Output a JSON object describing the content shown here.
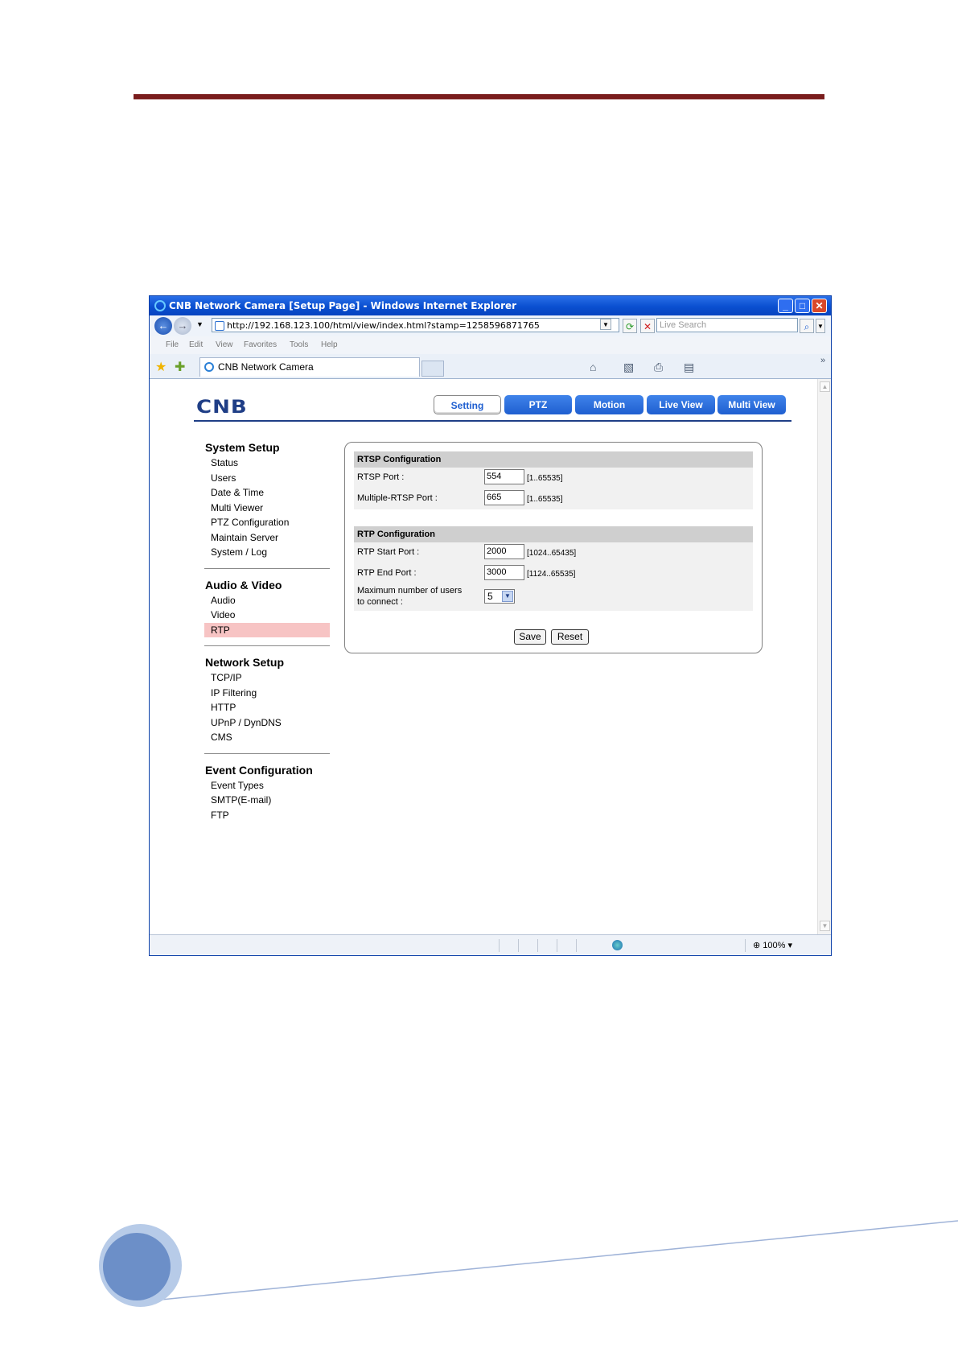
{
  "browser": {
    "window_title": "CNB Network Camera [Setup Page] - Windows Internet Explorer",
    "address": "http://192.168.123.100/html/view/index.html?stamp=1258596871765",
    "search_placeholder": "Live Search",
    "menu": [
      "File",
      "Edit",
      "View",
      "Favorites",
      "Tools",
      "Help"
    ],
    "tab_title": "CNB Network Camera",
    "zoom": "100%"
  },
  "app": {
    "logo": "CNB",
    "nav_tabs": [
      "Setting",
      "PTZ",
      "Motion",
      "Live View",
      "Multi View"
    ],
    "active_tab": "Setting"
  },
  "sidebar": {
    "sections": [
      {
        "title": "System Setup",
        "items": [
          "Status",
          "Users",
          "Date & Time",
          "Multi Viewer",
          "PTZ Configuration",
          "Maintain Server",
          "System / Log"
        ]
      },
      {
        "title": "Audio & Video",
        "items": [
          "Audio",
          "Video",
          "RTP"
        ]
      },
      {
        "title": "Network Setup",
        "items": [
          "TCP/IP",
          "IP Filtering",
          "HTTP",
          "UPnP / DynDNS",
          "CMS"
        ]
      },
      {
        "title": "Event Configuration",
        "items": [
          "Event Types",
          "SMTP(E-mail)",
          "FTP"
        ]
      }
    ],
    "active_item": "RTP"
  },
  "form": {
    "rtsp_header": "RTSP Configuration",
    "rtsp_port_label": "RTSP Port :",
    "rtsp_port_value": "554",
    "rtsp_port_range": "[1..65535]",
    "multi_rtsp_label": "Multiple-RTSP Port :",
    "multi_rtsp_value": "665",
    "multi_rtsp_range": "[1..65535]",
    "rtp_header": "RTP Configuration",
    "rtp_start_label": "RTP Start Port :",
    "rtp_start_value": "2000",
    "rtp_start_range": "[1024..65435]",
    "rtp_end_label": "RTP End Port :",
    "rtp_end_value": "3000",
    "rtp_end_range": "[1124..65535]",
    "max_users_label_1": "Maximum number of users",
    "max_users_label_2": "to connect :",
    "max_users_value": "5",
    "save_label": "Save",
    "reset_label": "Reset"
  }
}
